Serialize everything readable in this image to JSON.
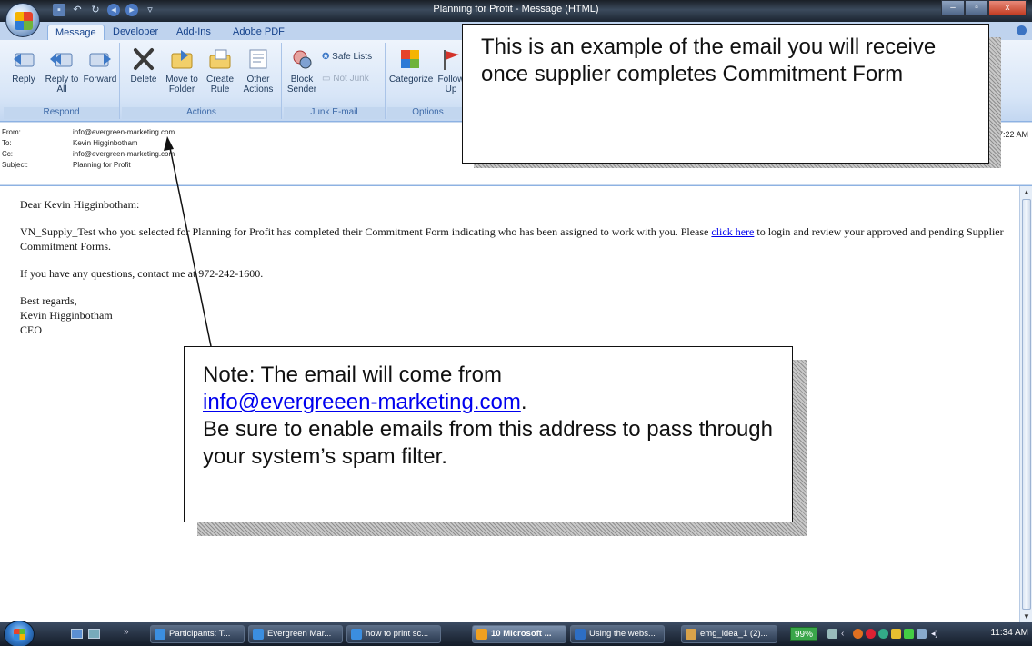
{
  "window": {
    "title": "Planning for Profit - Message (HTML)",
    "controls": {
      "minimize": "–",
      "maximize": "▫",
      "close": "x"
    }
  },
  "ribbon": {
    "tabs": [
      "Message",
      "Developer",
      "Add-Ins",
      "Adobe PDF"
    ],
    "active_tab": "Message",
    "groups": {
      "respond": {
        "label": "Respond",
        "buttons": [
          "Reply",
          "Reply to All",
          "Forward"
        ]
      },
      "actions": {
        "label": "Actions",
        "buttons": [
          "Delete",
          "Move to Folder",
          "Create Rule",
          "Other Actions"
        ]
      },
      "junk": {
        "label": "Junk E-mail",
        "block_sender": "Block Sender",
        "safe_lists": "Safe Lists",
        "not_junk": "Not Junk"
      },
      "options": {
        "label": "Options",
        "categorize": "Categorize",
        "follow_up": "Follow Up"
      }
    }
  },
  "headers": {
    "from_label": "From:",
    "from": "info@evergreen-marketing.com",
    "to_label": "To:",
    "to": "Kevin Higginbotham",
    "cc_label": "Cc:",
    "cc": "info@evergreen-marketing.com",
    "subject_label": "Subject:",
    "subject": "Planning for Profit",
    "sent_time_fragment": "2 7:22 AM"
  },
  "message": {
    "greeting": "Dear Kevin Higginbotham:",
    "para1_before_link": "VN_Supply_Test who you selected for Planning for Profit has completed their Commitment Form indicating who has been assigned to work with you. Please ",
    "link_text": "click here",
    "para1_after_link": " to login and review your approved and pending Supplier Commitment Forms.",
    "para2": "If you have any questions, contact me at 972-242-1600.",
    "closing": "Best regards,",
    "signature_name": "Kevin Higginbotham",
    "signature_title": "CEO"
  },
  "callouts": {
    "top": "This is an example of the email you will receive once supplier completes Commitment Form",
    "note_prefix": "Note: The email will come from ",
    "note_link": "info@evergreeen-marketing.com",
    "note_suffix": ".",
    "note_body": "Be sure to enable emails from this address to pass through your system’s spam filter."
  },
  "taskbar": {
    "items": [
      "Participants: T...",
      "Evergreen Mar...",
      "how to print sc...",
      "10 Microsoft ...",
      "Using the webs...",
      "emg_idea_1 (2)..."
    ],
    "battery": "99%",
    "clock": "11:34 AM"
  },
  "colors": {
    "ribbon_blue": "#c9d9ee",
    "link": "#0000ee",
    "battery_green": "#3aa64a"
  }
}
